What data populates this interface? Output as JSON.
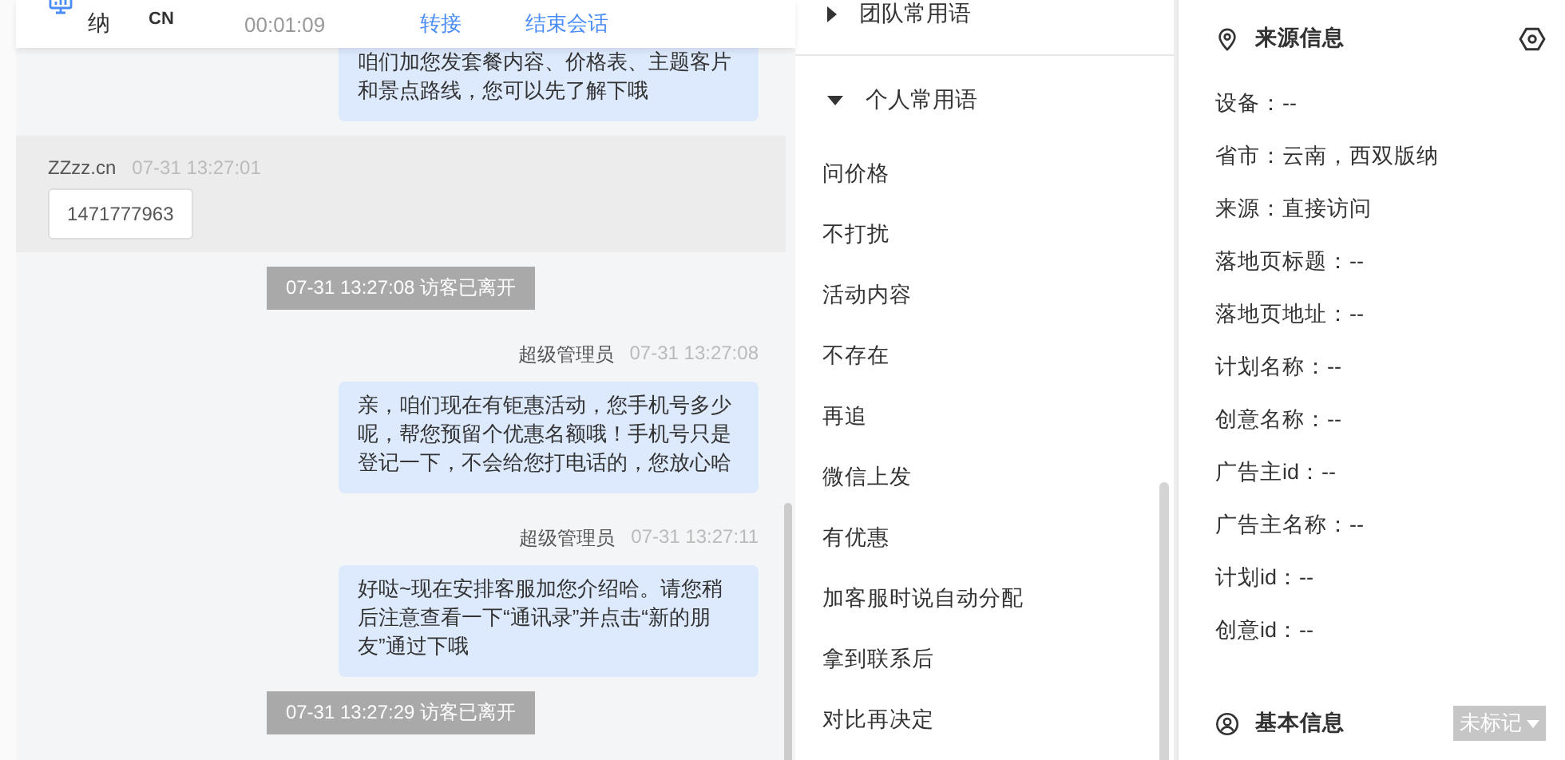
{
  "header": {
    "visitor_line": "纳",
    "visitor_name": "CN",
    "duration": "00:01:09",
    "transfer": "转接",
    "end_session": "结束会话"
  },
  "messages": [
    {
      "kind": "agent",
      "text": "咱们加您发套餐内容、价格表、主题客片和景点路线，您可以先了解下哦"
    },
    {
      "kind": "visitor",
      "sender": "ZZzz.cn",
      "time": "07-31 13:27:01",
      "text": "1471777963"
    },
    {
      "kind": "system",
      "text": "07-31 13:27:08 访客已离开"
    },
    {
      "kind": "agent",
      "sender": "超级管理员",
      "time": "07-31 13:27:08",
      "text": "亲，咱们现在有钜惠活动，您手机号多少呢，帮您预留个优惠名额哦！手机号只是登记一下，不会给您打电话的，您放心哈"
    },
    {
      "kind": "agent",
      "sender": "超级管理员",
      "time": "07-31 13:27:11",
      "text": "好哒~现在安排客服加您介绍哈。请您稍后注意查看一下“通讯录”并点击“新的朋友”通过下哦"
    },
    {
      "kind": "system",
      "text": "07-31 13:27:29 访客已离开"
    }
  ],
  "phrase_groups": [
    {
      "title": "团队常用语",
      "expanded": false
    },
    {
      "title": "个人常用语",
      "expanded": true,
      "items": [
        "问价格",
        "不打扰",
        "活动内容",
        "不存在",
        "再追",
        "微信上发",
        "有优惠",
        "加客服时说自动分配",
        "拿到联系后",
        "对比再决定"
      ]
    }
  ],
  "source_info": {
    "title": "来源信息",
    "fields": [
      "设备：--",
      "省市：云南，西双版纳",
      "来源：直接访问",
      "落地页标题：--",
      "落地页地址：--",
      "计划名称：--",
      "创意名称：--",
      "广告主id：--",
      "广告主名称：--",
      "计划id：--",
      "创意id：--"
    ]
  },
  "basic_info": {
    "title": "基本信息",
    "tag": "未标记"
  }
}
